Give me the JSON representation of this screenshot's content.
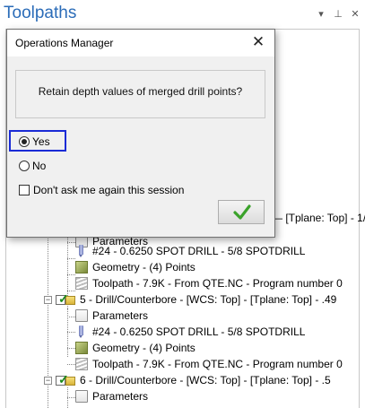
{
  "panel": {
    "title": "Toolpaths",
    "controls": {
      "pin": "▾",
      "autohide": "⊥",
      "close": "✕"
    }
  },
  "tree": {
    "partial_row": "— [Tplane: Top] - 1/",
    "rows": [
      {
        "type": "parameters",
        "label": "Parameters"
      },
      {
        "type": "tool",
        "label": "#24 - 0.6250 SPOT DRILL - 5/8 SPOTDRILL"
      },
      {
        "type": "geometry",
        "label": "Geometry - (4) Points"
      },
      {
        "type": "toolpath",
        "label": "Toolpath - 7.9K - From QTE.NC - Program number 0"
      },
      {
        "type": "operation",
        "label": "5 - Drill/Counterbore - [WCS: Top] - [Tplane: Top] - .49"
      },
      {
        "type": "parameters",
        "label": "Parameters"
      },
      {
        "type": "tool",
        "label": "#24 - 0.6250 SPOT DRILL - 5/8 SPOTDRILL"
      },
      {
        "type": "geometry",
        "label": "Geometry - (4) Points"
      },
      {
        "type": "toolpath",
        "label": "Toolpath - 7.9K - From QTE.NC - Program number 0"
      },
      {
        "type": "operation",
        "label": "6 - Drill/Counterbore - [WCS: Top] - [Tplane: Top] - .5"
      },
      {
        "type": "parameters",
        "label": "Parameters"
      }
    ]
  },
  "dialog": {
    "title": "Operations Manager",
    "message": "Retain depth values of merged drill points?",
    "options": [
      {
        "label": "Yes",
        "selected": true
      },
      {
        "label": "No",
        "selected": false
      }
    ],
    "checkbox_label": "Don't ask me again this session",
    "checkbox_checked": false,
    "ok_icon": "checkmark-icon",
    "focus_color": "#1a2bd6"
  },
  "colors": {
    "title_blue": "#2b6cb8",
    "check_green": "#3aa22a"
  }
}
